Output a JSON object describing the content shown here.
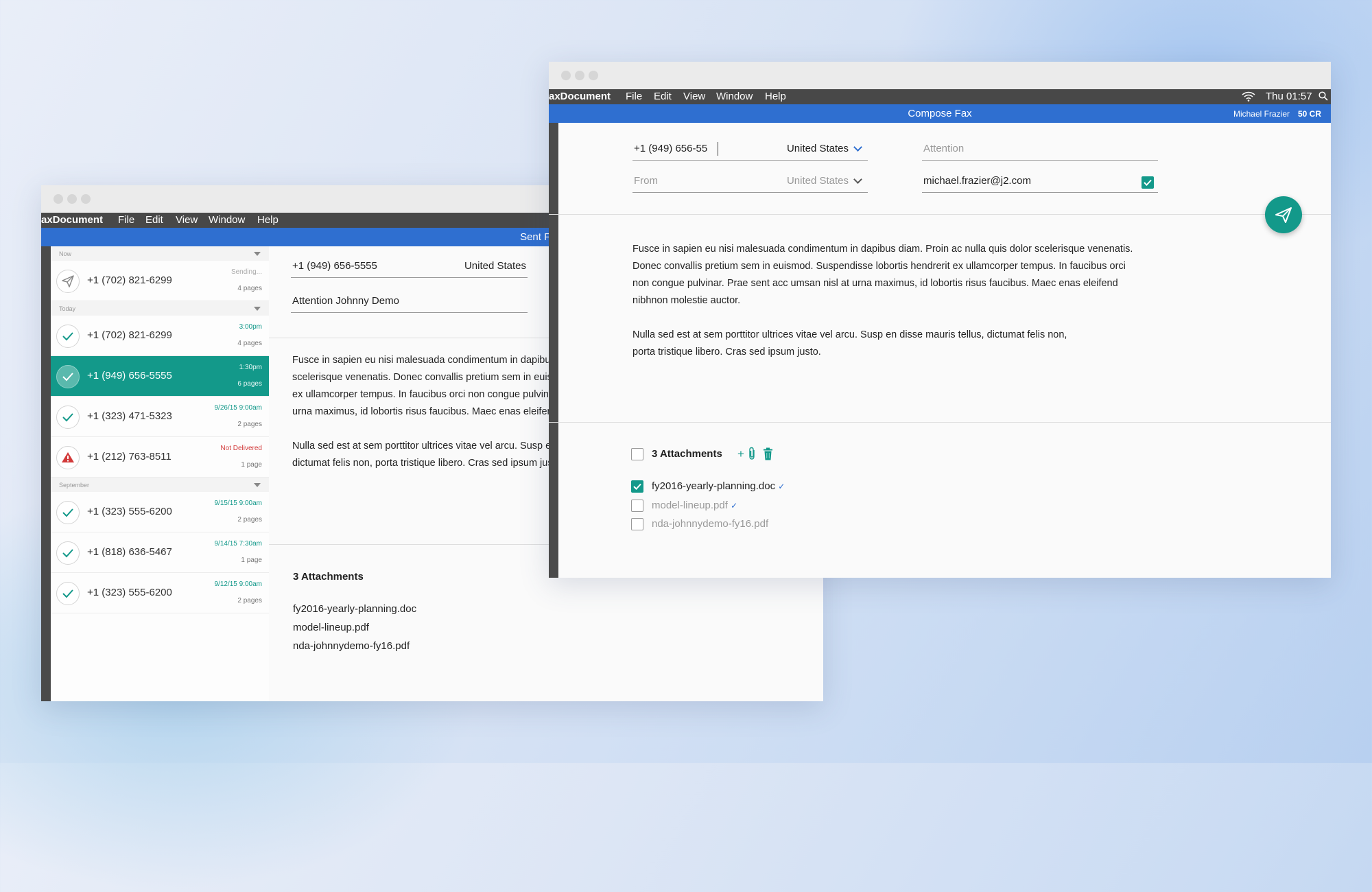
{
  "sent_window": {
    "menu": {
      "app": "axDocument",
      "items": [
        "File",
        "Edit",
        "View",
        "Window",
        "Help"
      ]
    },
    "header_title": "Sent Faxes",
    "sections": [
      {
        "label": "Now"
      },
      {
        "label": "Today"
      },
      {
        "label": "September"
      }
    ],
    "faxes": [
      {
        "number": "+1 (702) 821-6299",
        "status": "Sending...",
        "pages": "4 pages",
        "icon": "paper-plane-icon"
      },
      {
        "number": "+1 (702) 821-6299",
        "status": "3:00pm",
        "pages": "4 pages",
        "icon": "check-icon"
      },
      {
        "number": "+1 (949) 656-5555",
        "status": "1:30pm",
        "pages": "6 pages",
        "icon": "check-icon"
      },
      {
        "number": "+1 (323) 471-5323",
        "status": "9/26/15  9:00am",
        "pages": "2 pages",
        "icon": "check-icon"
      },
      {
        "number": "+1 (212) 763-8511",
        "status": "Not Delivered",
        "pages": "1 page",
        "icon": "warning-icon"
      },
      {
        "number": "+1 (323) 555-6200",
        "status": "9/15/15  9:00am",
        "pages": "2 pages",
        "icon": "check-icon"
      },
      {
        "number": "+1 (818) 636-5467",
        "status": "9/14/15  7:30am",
        "pages": "1 page",
        "icon": "check-icon"
      },
      {
        "number": "+1 (323) 555-6200",
        "status": "9/12/15  9:00am",
        "pages": "2 pages",
        "icon": "check-icon"
      }
    ],
    "detail": {
      "number": "+1 (949) 656-5555",
      "country": "United States",
      "attention": "Attention Johnny Demo",
      "body_p1": [
        "Fusce in sapien eu nisi malesuada condimentum in dapibus diam. Proin ac nulla quis dolor",
        "scelerisque venenatis. Donec convallis pretium sem in euismod. Suspendisse lobortis hendrerit",
        "ex ullamcorper tempus. In faucibus orci non congue pulvinar. Prae sent acc umsan nisl at",
        "urna maximus, id lobortis risus faucibus. Maec enas eleifend nibhnon molestie auctor."
      ],
      "body_p2": [
        "Nulla sed est at sem porttitor ultrices vitae vel arcu. Susp en disse mauris tellus,",
        "dictumat felis non, porta tristique libero. Cras sed ipsum justo."
      ],
      "attachments_title": "3 Attachments",
      "attachments": [
        "fy2016-yearly-planning.doc",
        "model-lineup.pdf",
        "nda-johnnydemo-fy16.pdf"
      ]
    }
  },
  "compose_window": {
    "menu": {
      "app": "axDocument",
      "items": [
        "File",
        "Edit",
        "View",
        "Window",
        "Help"
      ],
      "clock": "Thu 01:57"
    },
    "header_title": "Compose Fax",
    "user": "Michael Frazier",
    "credits": "50 CR",
    "to_number": "+1 (949) 656-55",
    "to_country": "United States",
    "attention_placeholder": "Attention",
    "from_placeholder": "From",
    "from_country": "United States",
    "email": "michael.frazier@j2.com",
    "email_checked": true,
    "body_p1": [
      "Fusce in sapien eu nisi malesuada condimentum in dapibus diam. Proin ac nulla quis dolor scelerisque venenatis.",
      "Donec convallis pretium sem in euismod. Suspendisse lobortis hendrerit ex ullamcorper tempus. In faucibus orci",
      "non congue pulvinar. Prae sent acc umsan nisl at urna maximus, id lobortis risus faucibus. Maec enas eleifend",
      "nibhnon molestie auctor."
    ],
    "body_p2": [
      "Nulla sed est at sem porttitor ultrices vitae vel arcu. Susp en disse mauris tellus, dictumat felis non,",
      "porta tristique libero. Cras sed ipsum justo."
    ],
    "attachments_title": "3 Attachments",
    "add_symbol": "+",
    "attachments": [
      {
        "name": "fy2016-yearly-planning.doc",
        "checked": true
      },
      {
        "name": "model-lineup.pdf",
        "checked": false
      },
      {
        "name": "nda-johnnydemo-fy16.pdf",
        "checked": false
      }
    ],
    "accent_color": "#13998a",
    "bar_color": "#2f6fd0"
  }
}
